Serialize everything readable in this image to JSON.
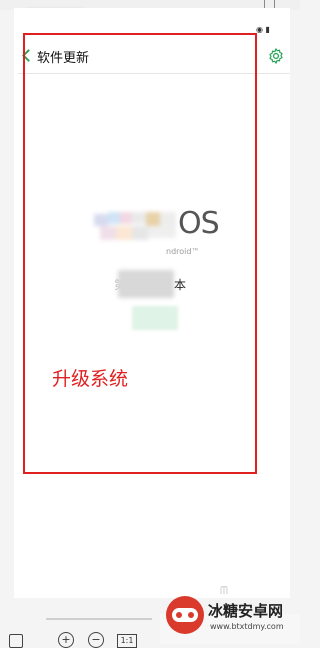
{
  "header": {
    "title": "软件更新"
  },
  "main": {
    "logo_suffix": "OS",
    "logo_sub": "ndroid™",
    "version_suffix": "本",
    "version_prefix": "第"
  },
  "annotation": {
    "text": "升级系统",
    "color": "#e02020"
  },
  "toolbar": {
    "zoom_in": "+",
    "zoom_out": "−",
    "page": "1:1"
  },
  "watermark": {
    "name": "冰糖安卓网",
    "url": "www.btxtdmy.com"
  },
  "colors": {
    "accent": "#2aa55a",
    "annotation_red": "#e02020"
  },
  "icons": [
    "back-chevron-icon",
    "gear-icon",
    "settings-icon"
  ]
}
